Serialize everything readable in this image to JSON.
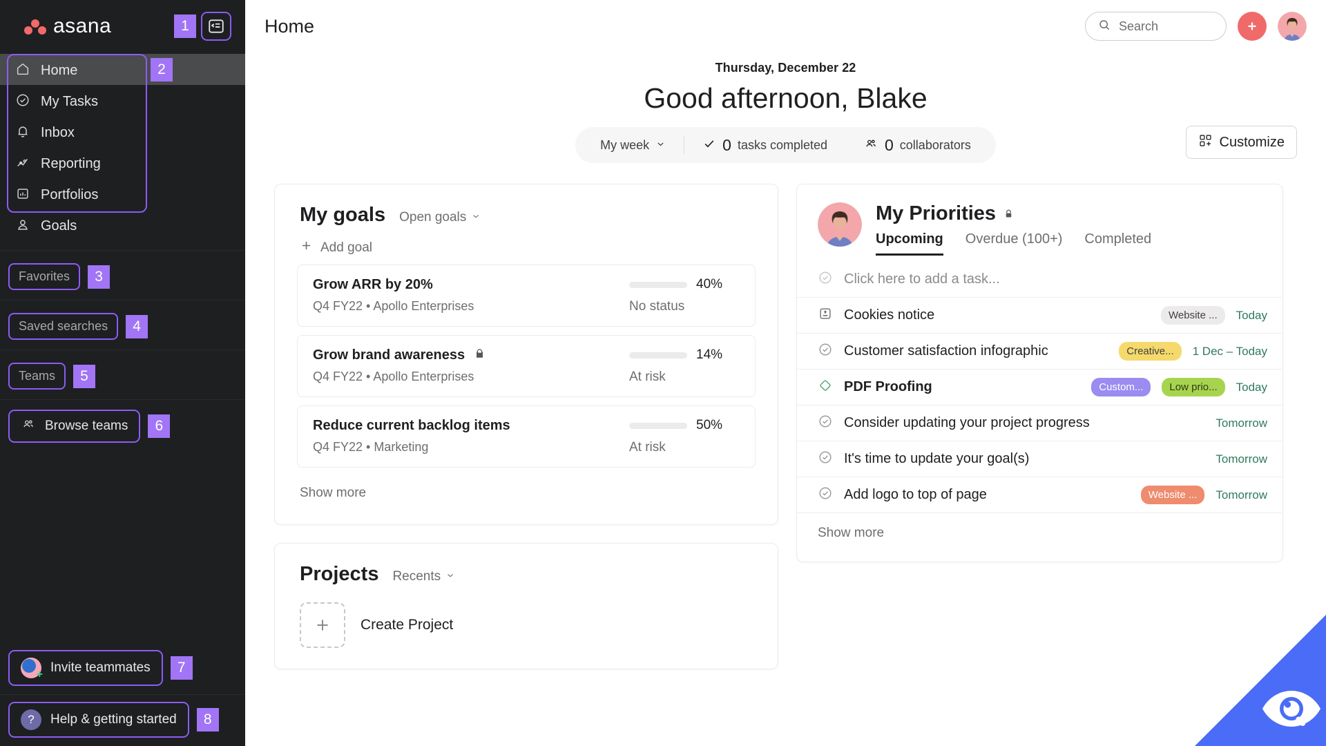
{
  "brand": {
    "name": "asana",
    "dot_color": "#f06a6a",
    "accent_purple": "#8b5cf6",
    "due_green": "#2f7a5b"
  },
  "sidebar": {
    "badges": [
      "1",
      "2",
      "3",
      "4",
      "5",
      "6",
      "7",
      "8"
    ],
    "collapse_icon": "sidebar-collapse-icon",
    "nav": [
      {
        "label": "Home",
        "icon": "home-icon",
        "active": true
      },
      {
        "label": "My Tasks",
        "icon": "check-circle-icon",
        "active": false
      },
      {
        "label": "Inbox",
        "icon": "bell-icon",
        "active": false
      },
      {
        "label": "Reporting",
        "icon": "line-chart-icon",
        "active": false
      },
      {
        "label": "Portfolios",
        "icon": "portfolio-icon",
        "active": false
      },
      {
        "label": "Goals",
        "icon": "goal-target-icon",
        "active": false
      }
    ],
    "sections": [
      {
        "label": "Favorites",
        "badge": "3"
      },
      {
        "label": "Saved searches",
        "badge": "4"
      },
      {
        "label": "Teams",
        "badge": "5"
      }
    ],
    "browse_teams": {
      "label": "Browse teams",
      "badge": "6",
      "icon": "people-icon"
    },
    "bottom": [
      {
        "label": "Invite teammates",
        "badge": "7",
        "icon": "invite-avatar-icon"
      },
      {
        "label": "Help & getting started",
        "badge": "8",
        "icon": "question-mark-icon"
      }
    ]
  },
  "topbar": {
    "page_title": "Home",
    "search_placeholder": "Search",
    "search_value": "",
    "create_label": "+",
    "avatar": "user-avatar"
  },
  "greeting": {
    "date": "Thursday, December 22",
    "title": "Good afternoon, Blake",
    "stats": {
      "range_label": "My week",
      "tasks_count": "0",
      "tasks_label": "tasks completed",
      "collaborators_count": "0",
      "collaborators_label": "collaborators"
    },
    "customize_label": "Customize"
  },
  "goals_card": {
    "title": "My goals",
    "filter_label": "Open goals",
    "add_label": "Add goal",
    "show_more": "Show more",
    "items": [
      {
        "name": "Grow ARR by 20%",
        "meta": "Q4 FY22 • Apollo Enterprises",
        "progress": "40%",
        "progress_value": 40,
        "bar_color": "#6d6e6f",
        "status": "No status",
        "locked": false
      },
      {
        "name": "Grow brand awareness",
        "meta": "Q4 FY22 • Apollo Enterprises",
        "progress": "14%",
        "progress_value": 14,
        "bar_color": "#f2b04a",
        "status": "At risk",
        "locked": true
      },
      {
        "name": "Reduce current backlog items",
        "meta": "Q4 FY22 • Marketing",
        "progress": "50%",
        "progress_value": 50,
        "bar_color": "#f2b04a",
        "status": "At risk",
        "locked": false
      }
    ]
  },
  "priorities_card": {
    "title": "My Priorities",
    "locked": true,
    "tabs": [
      {
        "label": "Upcoming",
        "active": true
      },
      {
        "label": "Overdue (100+)",
        "active": false
      },
      {
        "label": "Completed",
        "active": false
      }
    ],
    "add_task_placeholder": "Click here to add a task...",
    "show_more": "Show more",
    "tasks": [
      {
        "name": "Cookies notice",
        "icon": "approval-stamp-icon",
        "bold": false,
        "tags": [
          {
            "label": "Website ...",
            "bg": "#eceaea",
            "fg": "#3f4145"
          }
        ],
        "due": "Today"
      },
      {
        "name": "Customer satisfaction infographic",
        "icon": "check-circle-icon",
        "bold": false,
        "tags": [
          {
            "label": "Creative...",
            "bg": "#f5d96b",
            "fg": "#3f4145"
          }
        ],
        "due": "1 Dec – Today"
      },
      {
        "name": "PDF Proofing",
        "icon": "diamond-milestone-icon",
        "bold": true,
        "tags": [
          {
            "label": "Custom...",
            "bg": "#9a8cf0",
            "fg": "#ffffff"
          },
          {
            "label": "Low prio...",
            "bg": "#a7d44e",
            "fg": "#2e3b12"
          }
        ],
        "due": "Today"
      },
      {
        "name": "Consider updating your project progress",
        "icon": "check-circle-icon",
        "bold": false,
        "tags": [],
        "due": "Tomorrow"
      },
      {
        "name": "It's time to update your goal(s)",
        "icon": "check-circle-icon",
        "bold": false,
        "tags": [],
        "due": "Tomorrow"
      },
      {
        "name": "Add logo to top of page",
        "icon": "check-circle-icon",
        "bold": false,
        "tags": [
          {
            "label": "Website ...",
            "bg": "#ef8b6e",
            "fg": "#ffffff"
          }
        ],
        "due": "Tomorrow"
      }
    ]
  },
  "projects_card": {
    "title": "Projects",
    "filter_label": "Recents",
    "create_label": "Create Project"
  },
  "corner_watermark": {
    "icon": "eye-magnifier-icon",
    "color": "#4a6cf7"
  }
}
